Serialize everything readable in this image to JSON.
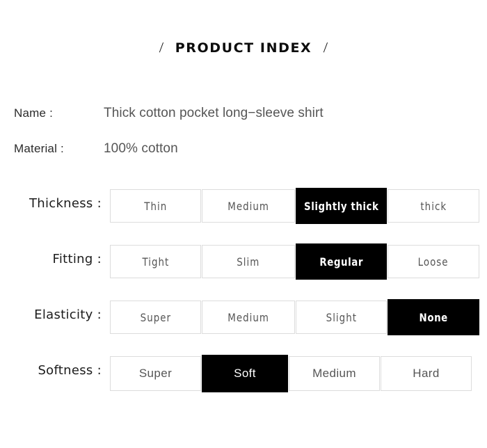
{
  "title": {
    "left_slash": "/",
    "text": "PRODUCT INDEX",
    "right_slash": "/"
  },
  "info": [
    {
      "label": "Name :",
      "value": "Thick cotton pocket long−sleeve shirt"
    },
    {
      "label": "Material :",
      "value": "100% cotton"
    }
  ],
  "specs": [
    {
      "label": "Thickness :",
      "options": [
        "Thin",
        "Medium",
        "Slightly thick",
        "thick"
      ],
      "selected_index": 2
    },
    {
      "label": "Fitting  :",
      "options": [
        "Tight",
        "Slim",
        "Regular",
        "Loose"
      ],
      "selected_index": 2
    },
    {
      "label": "Elasticity :",
      "options": [
        "Super",
        "Medium",
        "Slight",
        "None"
      ],
      "selected_index": 3
    },
    {
      "label": "Softness :",
      "options": [
        "Super",
        "Soft",
        "Medium",
        "Hard"
      ],
      "selected_index": 1
    }
  ],
  "colors": {
    "page_background": "#ffffff",
    "selected_background": "#000000",
    "selected_text": "#ffffff",
    "option_text": "#555555",
    "option_border": "#dcdcdc",
    "label_text": "#1c1c1c",
    "value_text": "#555555"
  }
}
